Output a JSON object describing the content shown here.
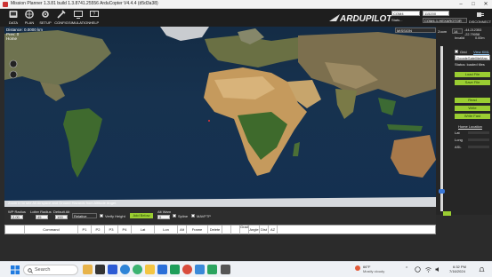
{
  "window": {
    "title": "Mission Planner 1.3.81 build 1.3.8741.25556 ArduCopter V4.4.4 (d5d3a38)",
    "controls": [
      "–",
      "□",
      "✕"
    ]
  },
  "toolbar": {
    "tools": [
      {
        "label": "DATA",
        "icon": "data-icon"
      },
      {
        "label": "PLAN",
        "icon": "plan-icon"
      },
      {
        "label": "SETUP",
        "icon": "setup-icon"
      },
      {
        "label": "CONFIG",
        "icon": "config-icon"
      },
      {
        "label": "SIMULATION",
        "icon": "simulation-icon"
      },
      {
        "label": "HELP",
        "icon": "help-icon"
      }
    ],
    "logo_text": "ARDUPILOT",
    "port": "COM4",
    "baud": "115200",
    "mode": "COM4-1-HEXAROTOR",
    "mode_label": "Stats...",
    "connect_label": "DISCONNECT"
  },
  "map_overlay": {
    "distance": "Distance: 0.0000 km",
    "prev": "Prev: 0",
    "home": "Home",
    "hint": "Zoom in to see All Airspace and Ground Hazards from Altitude Angel.",
    "coords_top": "-44.212353",
    "coords_mid": "-22.79058",
    "invalid": "Invalid",
    "meters": "0.00m",
    "dropdown_mission": "MISSION",
    "zoom_label": "Zoom",
    "zoom_value": "14"
  },
  "right_panel": {
    "grid_label": "Grid",
    "view_kml": "View KML",
    "map_provider": "GoogleSatelliteMap",
    "status": "Status: loaded tiles",
    "buttons": [
      "Load File",
      "Save File",
      "Read",
      "Write",
      "Write Fast"
    ],
    "home_location": "Home Location",
    "lat": "Lat",
    "long": "Long",
    "asl": "ASL"
  },
  "bottom": {
    "wp_radius_label": "WP Radius",
    "wp_radius": "2.00",
    "loiter_radius_label": "Loiter Radius",
    "loiter_radius": "45",
    "default_alt_label": "Default Alt",
    "default_alt": "100",
    "alt_mode": "Relative",
    "verify_height": "Verify Height",
    "add_below": "Add Below",
    "alt_warn_label": "Alt Warn",
    "alt_warn": "0",
    "spline": "Spline",
    "mavftp": "MAVFTP"
  },
  "waypoint_table": {
    "columns": [
      "",
      "Command",
      "P1",
      "P2",
      "P3",
      "P4",
      "Lat",
      "Lon",
      "Alt",
      "Frame",
      "Delete",
      "",
      "",
      "Grad %",
      "Angle",
      "Dist",
      "AZ"
    ]
  },
  "taskbar": {
    "search": "Search",
    "weather_temp": "66°F",
    "weather_text": "Mostly cloudy",
    "time": "6:32 PM",
    "date": "7/16/2024"
  }
}
